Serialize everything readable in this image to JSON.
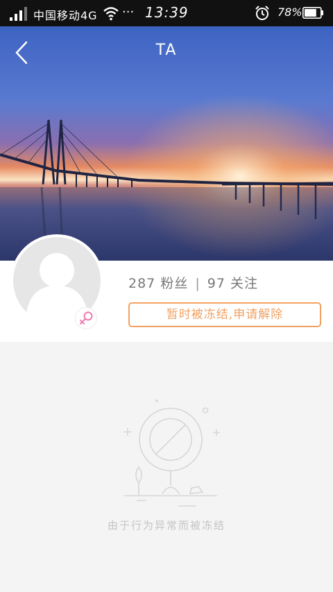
{
  "status_bar": {
    "carrier": "中国移动4G",
    "more": "···",
    "time": "13:39",
    "battery_percent": "78%",
    "battery_level": 0.78
  },
  "header": {
    "title": "TA"
  },
  "profile": {
    "fans_count": "287",
    "fans_label": "粉丝",
    "separator": "|",
    "following_count": "97",
    "following_label": "关注",
    "freeze_button_label": "暂时被冻结,申请解除",
    "gender": "female"
  },
  "empty_state": {
    "message": "由于行为异常而被冻结"
  },
  "colors": {
    "accent": "#f2a162",
    "gender_female": "#f07ab0",
    "status_bar_bg": "#111111"
  }
}
